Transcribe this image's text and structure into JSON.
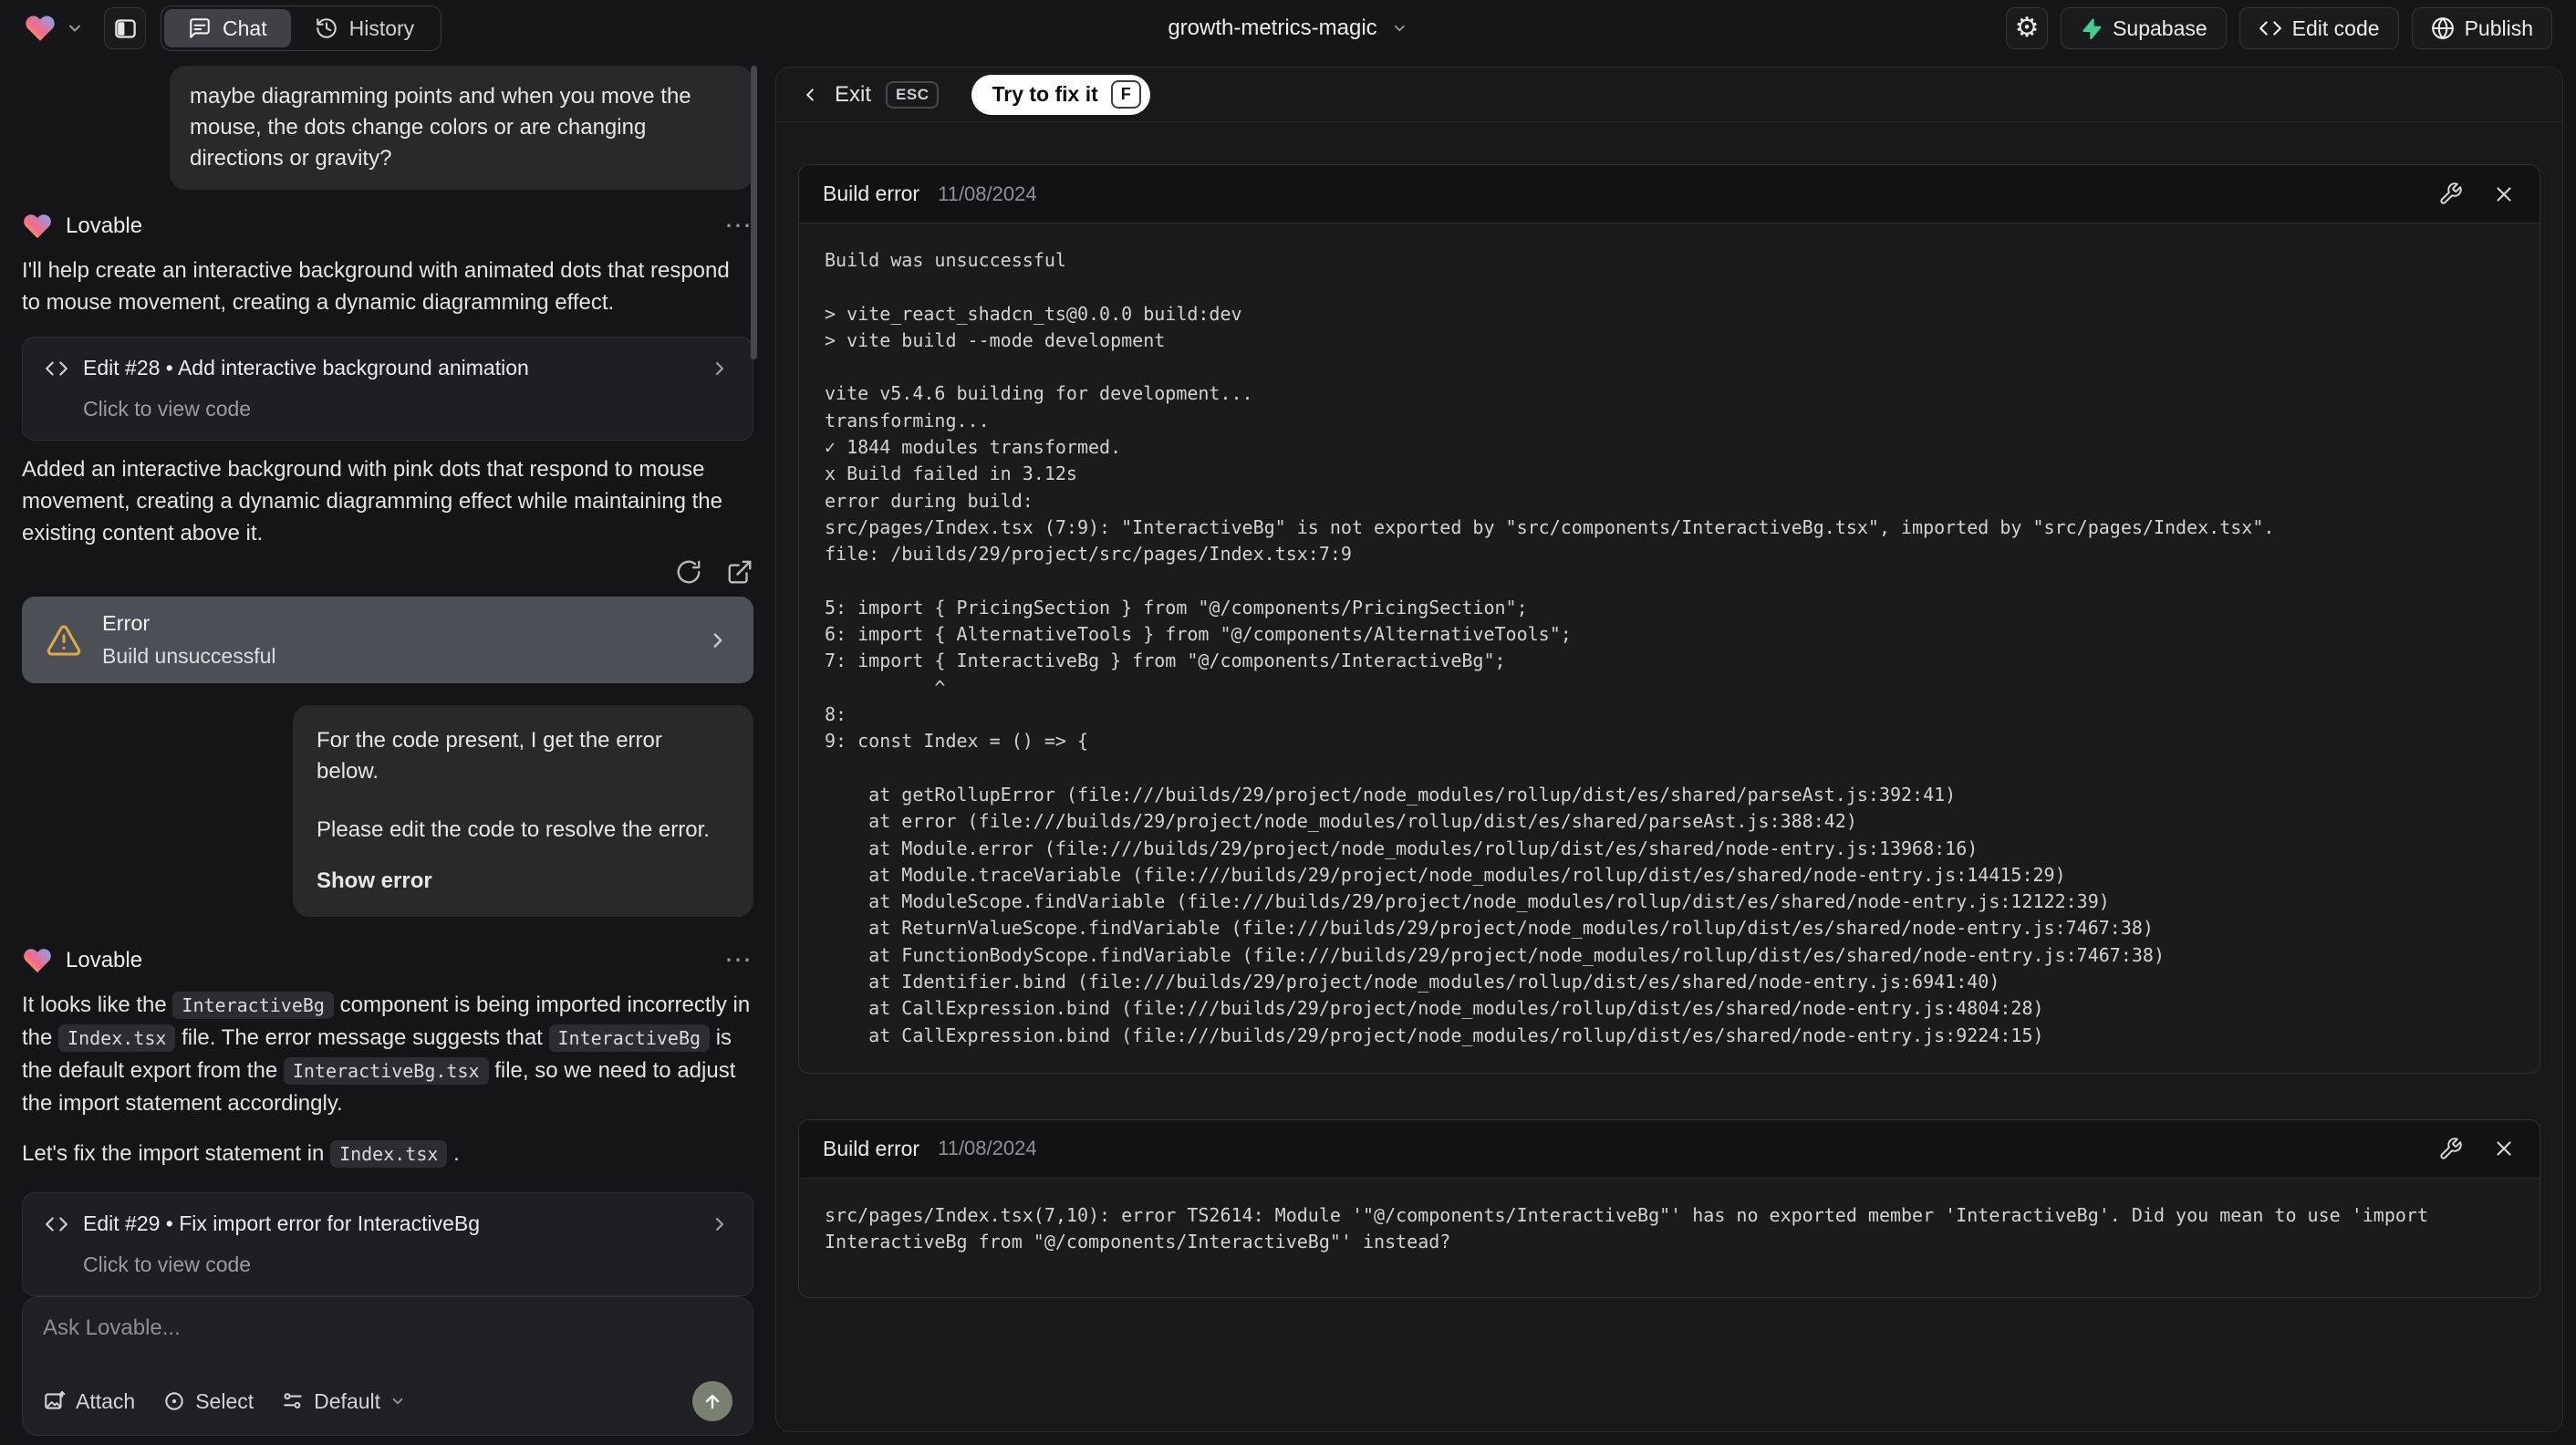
{
  "topbar": {
    "tabs": {
      "chat": "Chat",
      "history": "History"
    },
    "project_name": "growth-metrics-magic",
    "buttons": {
      "supabase": "Supabase",
      "edit_code": "Edit code",
      "publish": "Publish"
    }
  },
  "chat": {
    "assistant_name": "Lovable",
    "user_message_1": "maybe diagramming points and when you move the mouse, the dots change colors or are changing directions or gravity?",
    "intro_message": "I'll help create an interactive background with animated dots that respond to mouse movement, creating a dynamic diagramming effect.",
    "edit28": {
      "title": "Edit #28 • Add interactive background animation",
      "subtitle": "Click to view code"
    },
    "added_message": "Added an interactive background with pink dots that respond to mouse movement, creating a dynamic diagramming effect while maintaining the existing content above it.",
    "error_card": {
      "title": "Error",
      "subtitle": "Build unsuccessful"
    },
    "user_message_2": {
      "p1": "For the code present, I get the error below.",
      "p2": "Please edit the code to resolve the error.",
      "p3": "Show error"
    },
    "fix_message": {
      "s1": "It looks like the ",
      "c1": "InteractiveBg",
      "s2": " component is being imported incorrectly in the ",
      "c2": "Index.tsx",
      "s3": " file. The error message suggests that ",
      "c3": "InteractiveBg",
      "s4": " is the default export from the ",
      "c4": "InteractiveBg.tsx",
      "s5": " file, so we need to adjust the import statement accordingly."
    },
    "lets_fix_message": {
      "s1": "Let's fix the import statement in ",
      "c1": "Index.tsx",
      "s2": " ."
    },
    "edit29": {
      "title": "Edit #29 • Fix import error for InteractiveBg",
      "subtitle": "Click to view code"
    },
    "input": {
      "placeholder": "Ask Lovable...",
      "attach": "Attach",
      "select": "Select",
      "mode": "Default"
    }
  },
  "preview": {
    "exit_label": "Exit",
    "esc_key": "ESC",
    "fix_button_label": "Try to fix it",
    "fix_key": "F",
    "error1": {
      "title": "Build error",
      "date": "11/08/2024",
      "log": "Build was unsuccessful\n\n> vite_react_shadcn_ts@0.0.0 build:dev\n> vite build --mode development\n\nvite v5.4.6 building for development...\ntransforming...\n✓ 1844 modules transformed.\nx Build failed in 3.12s\nerror during build:\nsrc/pages/Index.tsx (7:9): \"InteractiveBg\" is not exported by \"src/components/InteractiveBg.tsx\", imported by \"src/pages/Index.tsx\".\nfile: /builds/29/project/src/pages/Index.tsx:7:9\n\n5: import { PricingSection } from \"@/components/PricingSection\";\n6: import { AlternativeTools } from \"@/components/AlternativeTools\";\n7: import { InteractiveBg } from \"@/components/InteractiveBg\";\n          ^\n8: \n9: const Index = () => {\n\n    at getRollupError (file:///builds/29/project/node_modules/rollup/dist/es/shared/parseAst.js:392:41)\n    at error (file:///builds/29/project/node_modules/rollup/dist/es/shared/parseAst.js:388:42)\n    at Module.error (file:///builds/29/project/node_modules/rollup/dist/es/shared/node-entry.js:13968:16)\n    at Module.traceVariable (file:///builds/29/project/node_modules/rollup/dist/es/shared/node-entry.js:14415:29)\n    at ModuleScope.findVariable (file:///builds/29/project/node_modules/rollup/dist/es/shared/node-entry.js:12122:39)\n    at ReturnValueScope.findVariable (file:///builds/29/project/node_modules/rollup/dist/es/shared/node-entry.js:7467:38)\n    at FunctionBodyScope.findVariable (file:///builds/29/project/node_modules/rollup/dist/es/shared/node-entry.js:7467:38)\n    at Identifier.bind (file:///builds/29/project/node_modules/rollup/dist/es/shared/node-entry.js:6941:40)\n    at CallExpression.bind (file:///builds/29/project/node_modules/rollup/dist/es/shared/node-entry.js:4804:28)\n    at CallExpression.bind (file:///builds/29/project/node_modules/rollup/dist/es/shared/node-entry.js:9224:15)"
    },
    "error2": {
      "title": "Build error",
      "date": "11/08/2024",
      "log": "src/pages/Index.tsx(7,10): error TS2614: Module '\"@/components/InteractiveBg\"' has no exported member 'InteractiveBg'. Did you mean to use 'import InteractiveBg from \"@/components/InteractiveBg\"' instead?"
    }
  },
  "colors": {
    "background": "#151517",
    "panel": "#19191c",
    "card": "#1f1f23",
    "error_selected_card": "#4c4f55",
    "warning_amber": "#ddab42",
    "supabase_green": "#3ecf8e",
    "fix_pill_white": "#ffffff",
    "send_button": "#798070",
    "terminal_text": "#d2d2d4"
  }
}
